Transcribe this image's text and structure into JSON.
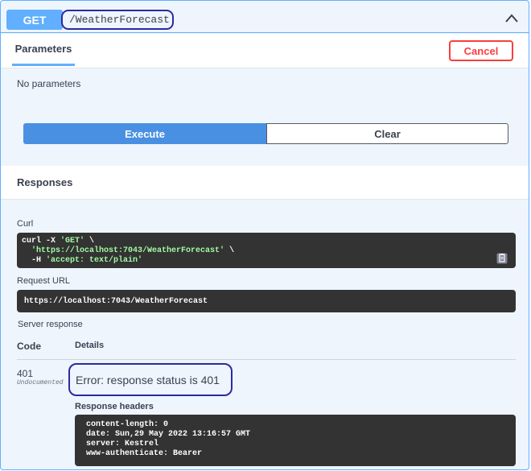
{
  "summary": {
    "method": "GET",
    "path": "/WeatherForecast"
  },
  "parameters": {
    "tab_label": "Parameters",
    "cancel_label": "Cancel",
    "empty_text": "No parameters"
  },
  "actions": {
    "execute_label": "Execute",
    "clear_label": "Clear"
  },
  "responses": {
    "title": "Responses",
    "curl_label": "Curl",
    "curl_lines": [
      {
        "pre": "curl -X ",
        "str": "'GET'",
        "post": " \\"
      },
      {
        "pre": "  ",
        "str": "'https://localhost:7043/WeatherForecast'",
        "post": " \\"
      },
      {
        "pre": "  -H ",
        "str": "'accept: text/plain'",
        "post": ""
      }
    ],
    "request_url_label": "Request URL",
    "request_url": "https://localhost:7043/WeatherForecast",
    "server_response_label": "Server response",
    "col_code": "Code",
    "col_details": "Details",
    "status_code": "401",
    "status_note": "Undocumented",
    "error_text": "Error: response status is 401",
    "response_headers_label": "Response headers",
    "response_headers": [
      "content-length: 0",
      "date: Sun,29 May 2022 13:16:57 GMT",
      "server: Kestrel",
      "www-authenticate: Bearer"
    ]
  },
  "icons": {
    "collapse": "chevron-up-icon",
    "copy": "copy-to-clipboard-icon"
  },
  "colors": {
    "get_accent": "#61affe",
    "execute": "#4990e2",
    "cancel": "#f93e3e",
    "code_bg": "#333333",
    "annotation": "#2b2ba0"
  }
}
